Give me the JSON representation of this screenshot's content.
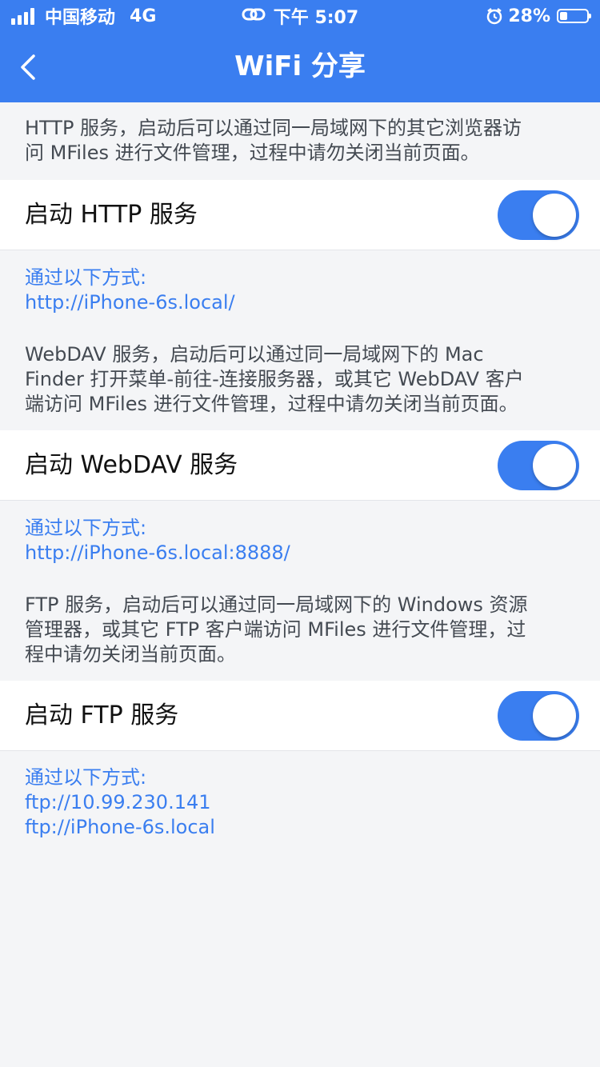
{
  "status_bar": {
    "carrier": "中国移动",
    "network": "4G",
    "time": "下午 5:07",
    "battery": "28%",
    "battery_level": 0.28
  },
  "nav": {
    "title": "WiFi 分享"
  },
  "sections": [
    {
      "description": "HTTP 服务，启动后可以通过同一局域网下的其它浏览器访\n问 MFiles 进行文件管理，过程中请勿关闭当前页面。",
      "toggle_label": "启动 HTTP 服务",
      "enabled": true,
      "access_label": "通过以下方式:",
      "addresses": [
        "http://iPhone-6s.local/"
      ]
    },
    {
      "description": "WebDAV 服务，启动后可以通过同一局域网下的 Mac\nFinder 打开菜单-前往-连接服务器，或其它 WebDAV 客户\n端访问 MFiles 进行文件管理，过程中请勿关闭当前页面。",
      "toggle_label": "启动 WebDAV 服务",
      "enabled": true,
      "access_label": "通过以下方式:",
      "addresses": [
        "http://iPhone-6s.local:8888/"
      ]
    },
    {
      "description": "FTP 服务，启动后可以通过同一局域网下的 Windows 资源\n管理器，或其它 FTP 客户端访问 MFiles 进行文件管理，过\n程中请勿关闭当前页面。",
      "toggle_label": "启动 FTP 服务",
      "enabled": true,
      "access_label": "通过以下方式:",
      "addresses": [
        "ftp://10.99.230.141",
        "ftp://iPhone-6s.local"
      ]
    }
  ],
  "colors": {
    "accent": "#3a7ef0",
    "background": "#f4f5f7",
    "row_background": "#ffffff",
    "description_text": "#444a52"
  }
}
